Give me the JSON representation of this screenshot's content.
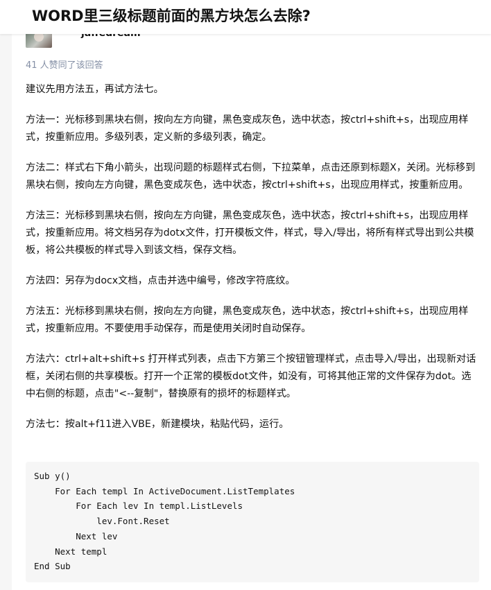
{
  "header": {
    "question_title": "WORD里三级标题前面的黑方块怎么去除?"
  },
  "answer": {
    "author_name": "jaffedream",
    "votes_text": "41 人赞同了该回答",
    "paragraphs": [
      "建议先用方法五，再试方法七。",
      "方法一：光标移到黑块右侧，按向左方向键，黑色变成灰色，选中状态，按ctrl+shift+s，出现应用样式，按重新应用。多级列表，定义新的多级列表，确定。",
      "方法二：样式右下角小箭头，出现问题的标题样式右侧，下拉菜单，点击还原到标题X，关闭。光标移到黑块右侧，按向左方向键，黑色变成灰色，选中状态，按ctrl+shift+s，出现应用样式，按重新应用。",
      "方法三：光标移到黑块右侧，按向左方向键，黑色变成灰色，选中状态，按ctrl+shift+s，出现应用样式，按重新应用。将文档另存为dotx文件，打开模板文件，样式，导入/导出，将所有样式导出到公共模板，将公共模板的样式导入到该文档，保存文档。",
      "方法四：另存为docx文档，点击并选中编号，修改字符底纹。",
      "方法五：光标移到黑块右侧，按向左方向键，黑色变成灰色，选中状态，按ctrl+shift+s，出现应用样式，按重新应用。不要使用手动保存，而是使用关闭时自动保存。",
      "方法六：ctrl+alt+shift+s 打开样式列表，点击下方第三个按钮管理样式，点击导入/导出，出现新对话框，关闭右侧的共享模板。打开一个正常的模板dot文件，如没有，可将其他正常的文件保存为dot。选中右侧的标题，点击\"<--复制\"，替换原有的损坏的标题样式。",
      "方法七：按alt+f11进入VBE，新建模块，粘贴代码，运行。"
    ],
    "code_lines": [
      "Sub y()",
      "    For Each templ In ActiveDocument.ListTemplates",
      "        For Each lev In templ.ListLevels",
      "            lev.Font.Reset",
      "        Next lev",
      "    Next templ",
      "End Sub"
    ]
  },
  "colors": {
    "meta_gray": "#8590a6",
    "text": "#121212",
    "code_bg": "#f6f6f6"
  }
}
